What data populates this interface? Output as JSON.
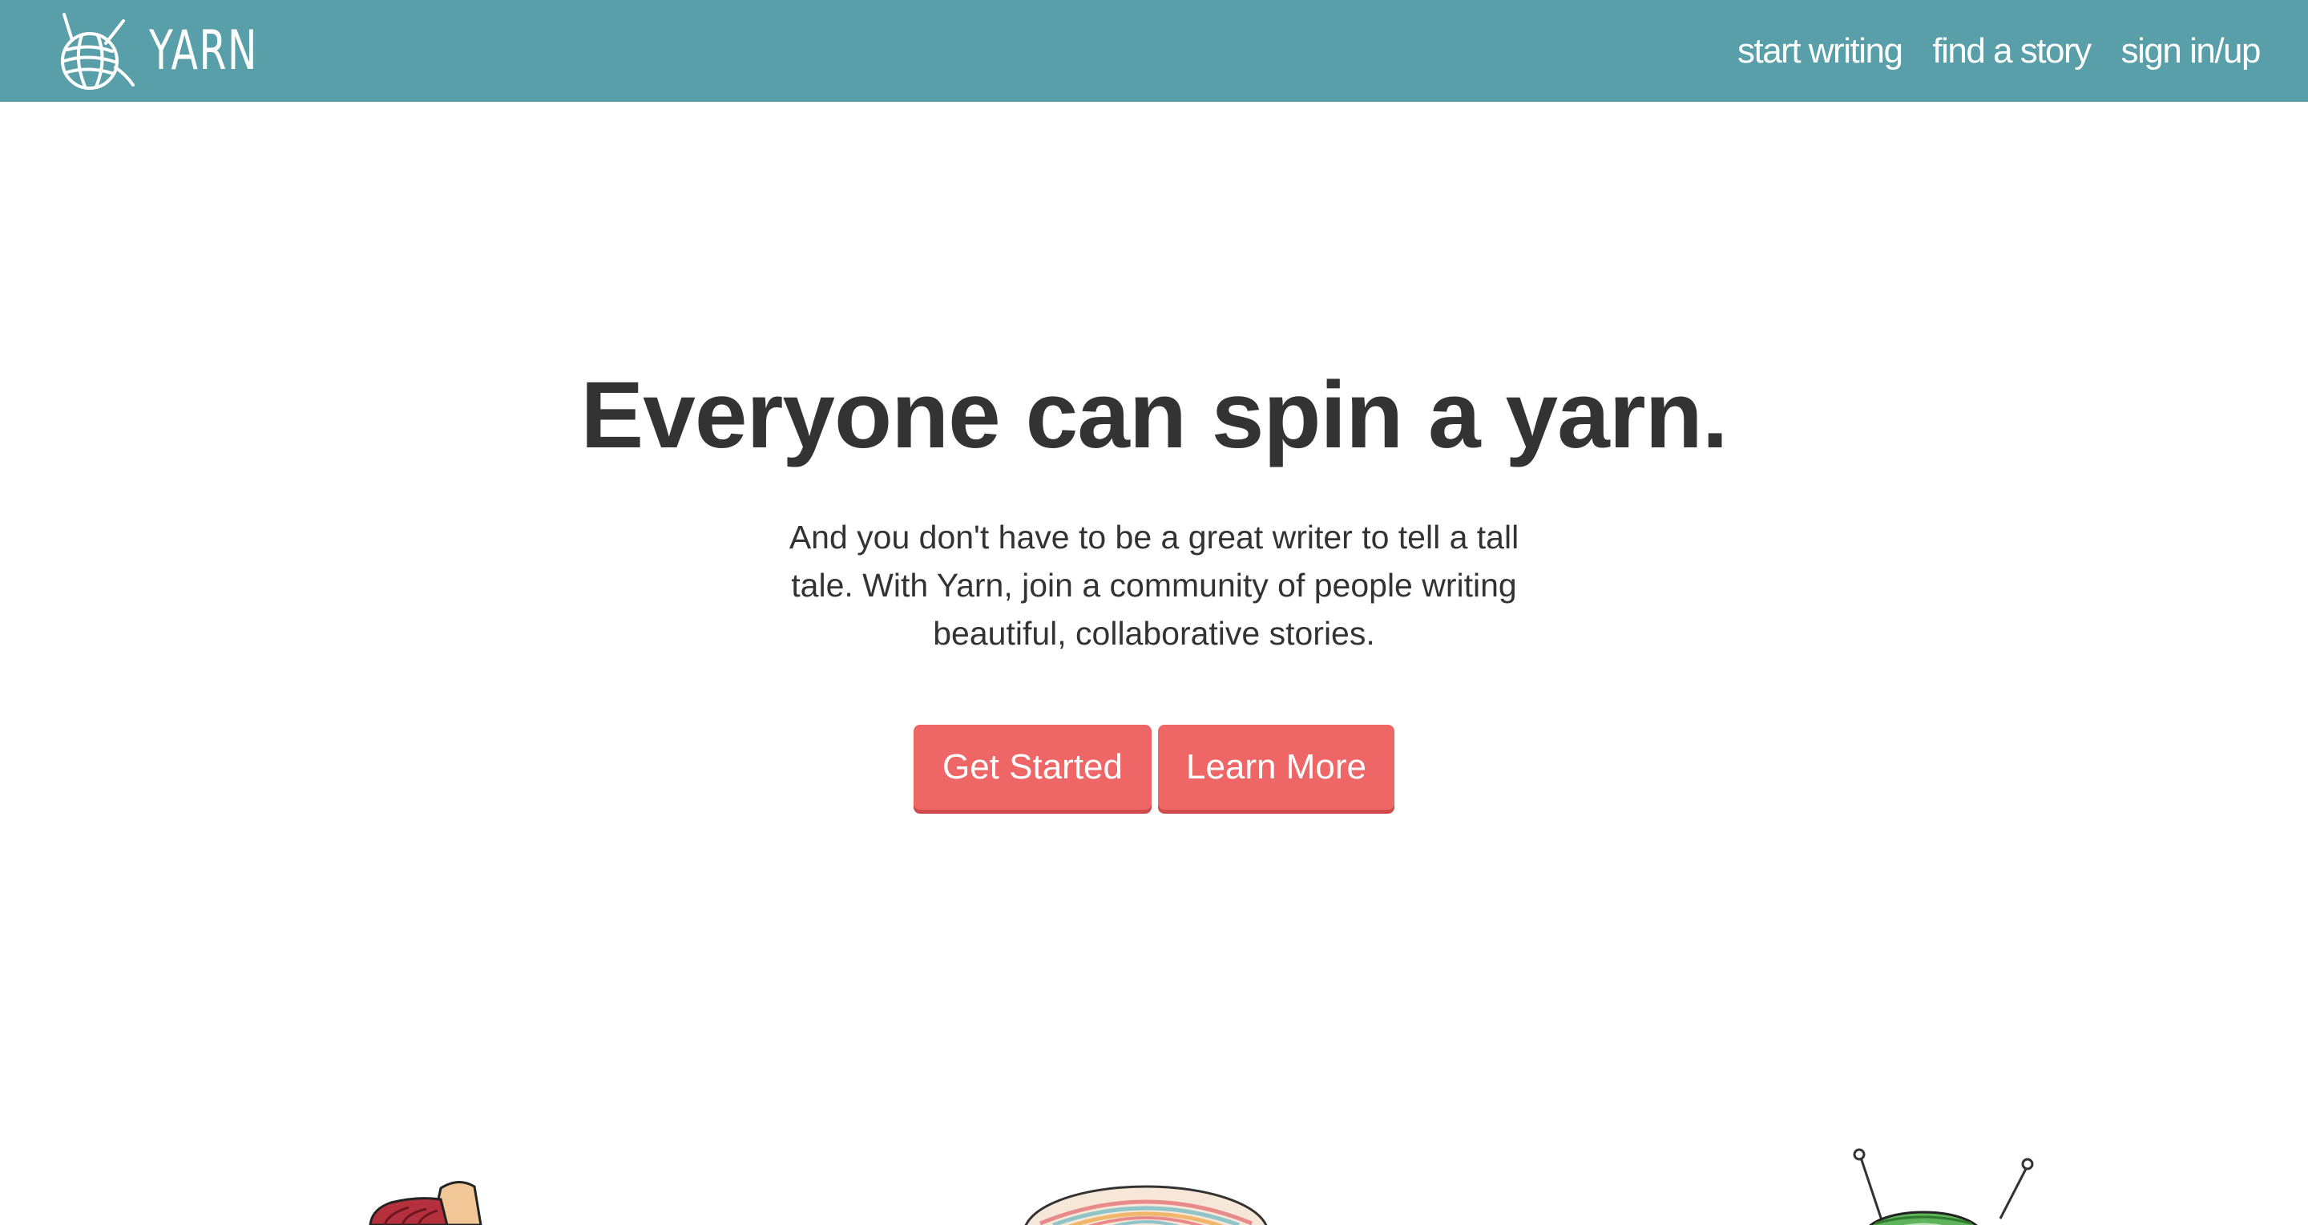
{
  "app": {
    "brand_name": "YARN"
  },
  "nav": {
    "links": [
      {
        "label": "start writing"
      },
      {
        "label": "find a story"
      },
      {
        "label": "sign in/up"
      }
    ]
  },
  "hero": {
    "title": "Everyone can spin a yarn.",
    "text": "And you don't have to be a great writer to tell a tall tale. With Yarn, join a community of people writing beautiful, collaborative stories.",
    "buttons": {
      "get_started": "Get Started",
      "learn_more": "Learn More"
    }
  },
  "icons": {
    "logo": "yarn-ball-logo-icon",
    "decorations": [
      "yarn-spool-icon",
      "yarn-ball-pattern-icon",
      "yarn-ball-needles-icon"
    ]
  },
  "colors": {
    "navbar": "#589faa",
    "button": "#ee6666",
    "text": "#333333",
    "background": "#ffffff"
  }
}
